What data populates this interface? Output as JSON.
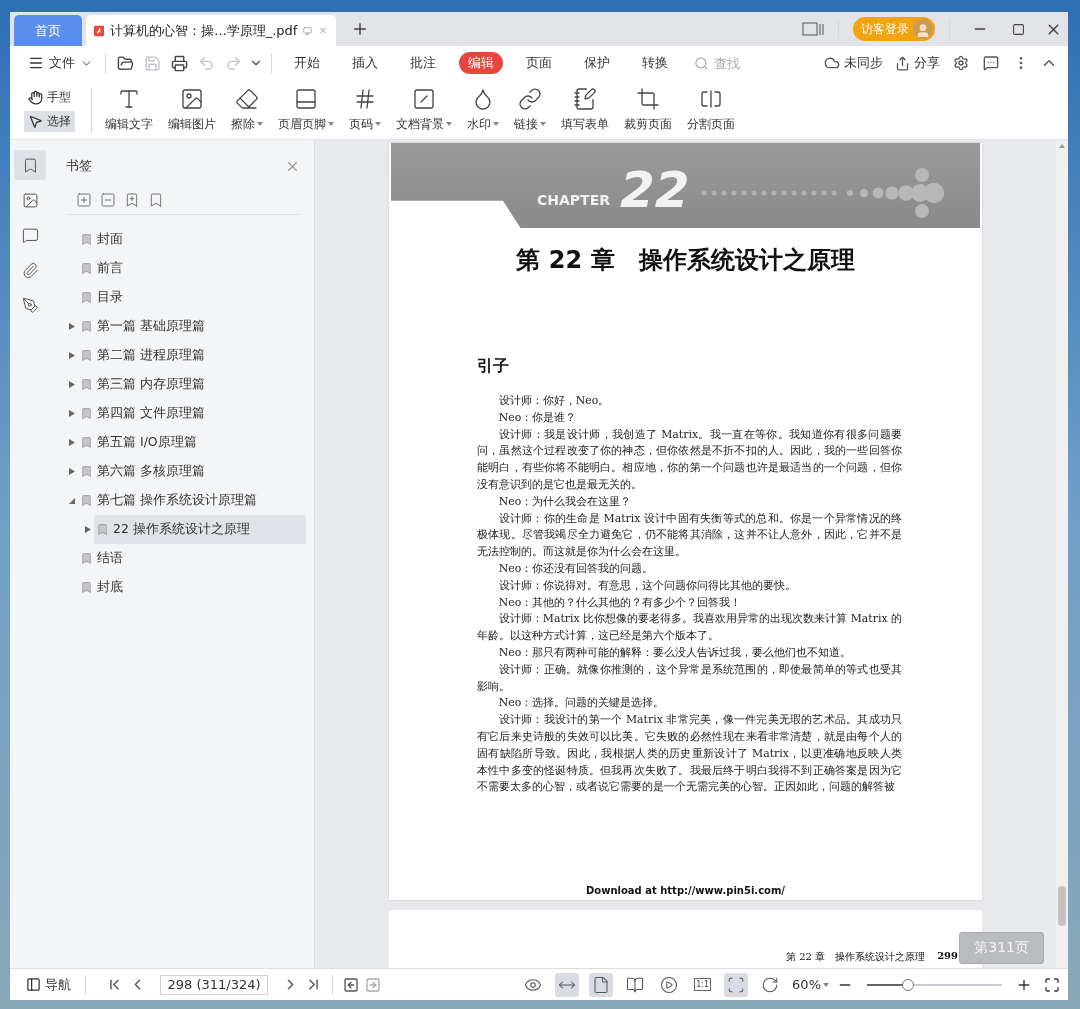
{
  "tabs": [
    {
      "label": "首页",
      "kind": "home"
    },
    {
      "label": "计算机的心智：操...学原理_.pdf",
      "kind": "document"
    }
  ],
  "account": {
    "label": "访客登录"
  },
  "menu": {
    "file": "文件",
    "quick_actions": [
      {
        "disabled": false
      },
      {
        "disabled": true
      },
      {
        "disabled": false
      },
      {
        "disabled": true
      },
      {
        "disabled": true
      }
    ],
    "tabs": [
      {
        "label": "开始",
        "selected": false
      },
      {
        "label": "插入",
        "selected": false
      },
      {
        "label": "批注",
        "selected": false
      },
      {
        "label": "编辑",
        "selected": true
      },
      {
        "label": "页面",
        "selected": false
      },
      {
        "label": "保护",
        "selected": false
      },
      {
        "label": "转换",
        "selected": false
      }
    ],
    "search": {
      "placeholder": "查找"
    },
    "sync": "未同步",
    "share": "分享"
  },
  "ribbon": {
    "modes": [
      {
        "label": "手型",
        "selected": false
      },
      {
        "label": "选择",
        "selected": true
      }
    ],
    "tools": [
      {
        "label": "编辑文字",
        "dropdown": false
      },
      {
        "label": "编辑图片",
        "dropdown": false
      },
      {
        "label": "擦除",
        "dropdown": true
      },
      {
        "label": "页眉页脚",
        "dropdown": true
      },
      {
        "label": "页码",
        "dropdown": true
      },
      {
        "label": "文档背景",
        "dropdown": true
      },
      {
        "label": "水印",
        "dropdown": true
      },
      {
        "label": "链接",
        "dropdown": true
      },
      {
        "label": "填写表单",
        "dropdown": false
      },
      {
        "label": "裁剪页面",
        "dropdown": false
      },
      {
        "label": "分割页面",
        "dropdown": false
      }
    ]
  },
  "side_tabs": [
    {
      "selected": true
    },
    {
      "selected": false
    },
    {
      "selected": false
    },
    {
      "selected": false
    },
    {
      "selected": false
    }
  ],
  "bookmarks": {
    "title": "书签",
    "items": [
      {
        "label": "封面",
        "kind": "leaf",
        "selected": false
      },
      {
        "label": "前言",
        "kind": "leaf",
        "selected": false
      },
      {
        "label": "目录",
        "kind": "leaf",
        "selected": false
      },
      {
        "label": "第一篇 基础原理篇",
        "kind": "folder",
        "expanded": false,
        "selected": false
      },
      {
        "label": "第二篇 进程原理篇",
        "kind": "folder",
        "expanded": false,
        "selected": false
      },
      {
        "label": "第三篇 内存原理篇",
        "kind": "folder",
        "expanded": false,
        "selected": false
      },
      {
        "label": "第四篇 文件原理篇",
        "kind": "folder",
        "expanded": false,
        "selected": false
      },
      {
        "label": "第五篇 I/O原理篇",
        "kind": "folder",
        "expanded": false,
        "selected": false
      },
      {
        "label": "第六篇 多核原理篇",
        "kind": "folder",
        "expanded": false,
        "selected": false
      },
      {
        "label": "第七篇 操作系统设计原理篇",
        "kind": "folder",
        "expanded": true,
        "selected": false,
        "children": [
          {
            "label": "22 操作系统设计之原理",
            "kind": "folder",
            "expanded": false,
            "selected": true
          }
        ]
      },
      {
        "label": "结语",
        "kind": "leaf",
        "selected": false
      },
      {
        "label": "封底",
        "kind": "leaf",
        "selected": false
      }
    ]
  },
  "document": {
    "chapter_banner": {
      "word": "CHAPTER",
      "number": "22"
    },
    "title": "第 22 章　操作系统设计之原理",
    "section": "引子",
    "paragraphs": [
      "设计师：你好，Neo。",
      "Neo：你是谁？",
      "设计师：我是设计师，我创造了 Matrix。我一直在等你。我知道你有很多问题要问，虽然这个过程改变了你的神态，但你依然是不折不扣的人。因此，我的一些回答你能明白，有些你将不能明白。相应地，你的第一个问题也许是最适当的一个问题，但你没有意识到的是它也是最无关的。",
      "Neo：为什么我会在这里？",
      "设计师：你的生命是 Matrix 设计中固有失衡等式的总和。你是一个异常情况的终极体现。尽管我竭尽全力避免它，仍不能将其消除，这并不让人意外，因此，它并不是无法控制的。而这就是你为什么会在这里。",
      "Neo：你还没有回答我的问题。",
      "设计师：你说得对。有意思，这个问题你问得比其他的要快。",
      "Neo：其他的？什么其他的？有多少个？回答我！",
      "设计师：Matrix 比你想像的要老得多。我喜欢用异常的出现次数来计算 Matrix 的年龄。以这种方式计算，这已经是第六个版本了。",
      "Neo：那只有两种可能的解释：要么没人告诉过我，要么他们也不知道。",
      "设计师：正确。就像你推测的，这个异常是系统范围的，即使最简单的等式也受其影响。",
      "Neo：选择。问题的关键是选择。",
      "设计师：我设计的第一个 Matrix 非常完美，像一件完美无瑕的艺术品。其成功只有它后来史诗般的失效可以比美。它失败的必然性现在来看非常清楚，就是由每个人的固有缺陷所导致。因此，我根据人类的历史重新设计了 Matrix，以更准确地反映人类本性中多变的怪诞特质。但我再次失败了。我最后终于明白我得不到正确答案是因为它不需要太多的心智，或者说它需要的是一个无需完美的心智。正因如此，问题的解答被"
    ],
    "footer": "Download at http://www.pin5i.com/",
    "next_page_header": {
      "chapter": "第 22 章　操作系统设计之原理",
      "page": "299"
    },
    "page_badge": "第311页"
  },
  "status_bar": {
    "nav": "导航",
    "page_field": "298 (311/324)",
    "view_tools": [
      {
        "selected": false
      },
      {
        "selected": true
      },
      {
        "selected": true
      },
      {
        "selected": false
      },
      {
        "selected": false
      },
      {
        "selected": false,
        "label": "1:1"
      },
      {
        "selected": true
      },
      {
        "selected": false
      }
    ],
    "zoom": "60%",
    "zoom_slider": {
      "level": 0.3
    }
  }
}
